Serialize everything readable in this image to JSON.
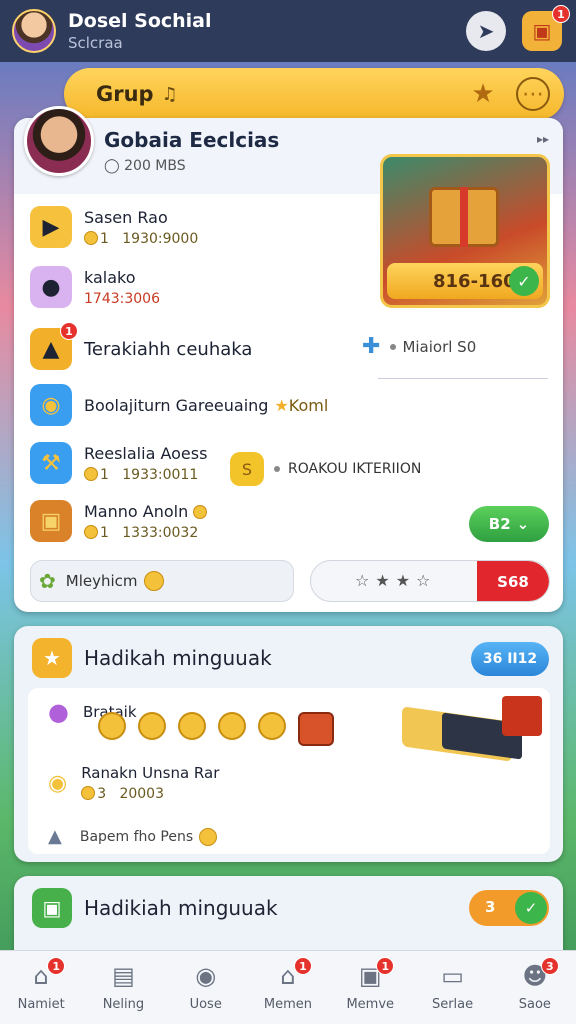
{
  "header": {
    "title": "Dosel Sochial",
    "subtitle": "Sclcraa",
    "gift_badge": "1"
  },
  "grup": {
    "label": "Grup"
  },
  "profile": {
    "name": "Gobaia Eeclcias",
    "sub": "200 MBS"
  },
  "reward": {
    "amount": "816-160"
  },
  "rows": [
    {
      "title": "Sasen Rao",
      "value": "1   1930:9000"
    },
    {
      "title": "kalako",
      "value": "1743:3006"
    },
    {
      "title": "Terakiahh ceuhaka",
      "badge": "1"
    },
    {
      "title": "Boolajiturn Gareeuaing",
      "extra": "Koml"
    },
    {
      "title": "Reeslalia Aoess",
      "value": "1   1933:0011"
    },
    {
      "title": "Manno Anoln",
      "value": "1   1333:0032"
    }
  ],
  "right_note": "Miaiorl S0",
  "mid_note": "ROAKOU IKTERIION",
  "green_button": "B2",
  "search": {
    "label": "Mleyhicm"
  },
  "toggle": {
    "value": "S68"
  },
  "section2": {
    "title": "Hadikah minguuak",
    "pill": "36 II12",
    "item1": "Brataik",
    "item2": "Ranakn Unsna Rar",
    "item2_value": "3   20003",
    "item3": "Bapem fho Pens"
  },
  "section3": {
    "title": "Hadikiah minguuak",
    "pill_value": "3"
  },
  "nav": [
    {
      "label": "Namiet",
      "icon": "home-icon",
      "badge": "1"
    },
    {
      "label": "Neling",
      "icon": "stack-icon",
      "badge": ""
    },
    {
      "label": "Uose",
      "icon": "card-icon",
      "badge": ""
    },
    {
      "label": "Memen",
      "icon": "house-icon",
      "badge": "1"
    },
    {
      "label": "Memve",
      "icon": "box-icon",
      "badge": "1"
    },
    {
      "label": "Serlae",
      "icon": "page-icon",
      "badge": ""
    },
    {
      "label": "Saoe",
      "icon": "user-icon",
      "badge": "3"
    }
  ]
}
